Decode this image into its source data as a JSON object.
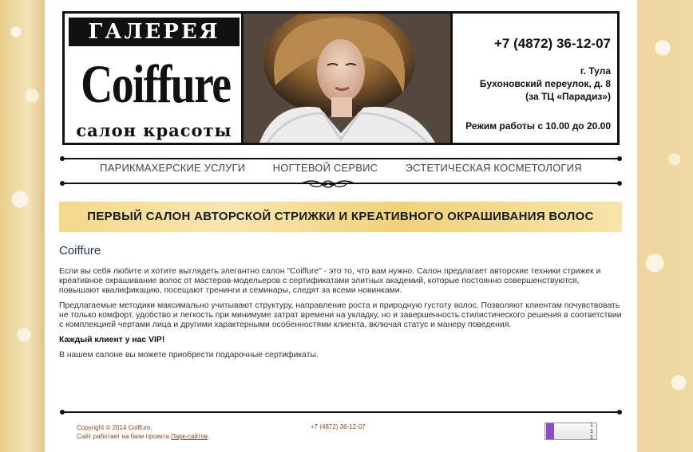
{
  "header": {
    "logo_top": "ГАЛЕРЕЯ",
    "logo_main": "Coiffure",
    "logo_sub": "салон красоты",
    "phone": "+7 (4872) 36-12-07",
    "city": "г. Тула",
    "street": "Бухоновский переулок, д. 8",
    "landmark": "(за ТЦ «Парадиз»)",
    "hours": "Режим работы с 10.00 до 20.00"
  },
  "nav": {
    "items": [
      {
        "label": "ПАРИКМАХЕРСКИЕ УСЛУГИ"
      },
      {
        "label": "НОГТЕВОЙ СЕРВИС"
      },
      {
        "label": "ЭСТЕТИЧЕСКАЯ КОСМЕТОЛОГИЯ"
      }
    ]
  },
  "banner": {
    "text": "ПЕРВЫЙ САЛОН АВТОРСКОЙ СТРИЖКИ И КРЕАТИВНОГО ОКРАШИВАНИЯ ВОЛОС"
  },
  "content": {
    "title": "Coiffure",
    "p1": "Если вы себя любите и хотите выглядеть элегантно салон \"Coiffure\" - это то, что вам нужно. Салон предлагает авторские техники стрижек и креативное окрашивание волос от мастеров-модельеров с сертификатами элитных академий, которые постоянно совершенствуются, повышают квалификацию, посещают тренинги и семинары, следят за всеми новинками.",
    "p2": "Предлагаемые методики максимально учитывают структуру, направление роста и природную густоту волос. Позволяют клиентам почувствовать не только комфорт, удобство и легкость при минимуме затрат времени на укладку, но и завершенность стилистического решения в соответствии с комплекцией чертами лица и другими характерными особенностями клиента, включая статус и манеру поведения.",
    "p3": "Каждый клиент у нас VIP!",
    "p4": "В нашем салоне вы можете приобрести подарочные сертификаты."
  },
  "footer": {
    "copyright": "Copyright © 2014 Coiffure.",
    "powered_prefix": "Сайт работает на базе проекта ",
    "powered_link": "Парк-сайтов",
    "powered_suffix": ".",
    "phone": "+7 (4872) 36-12-07",
    "counter_lines": [
      "1",
      "1",
      "1"
    ]
  }
}
